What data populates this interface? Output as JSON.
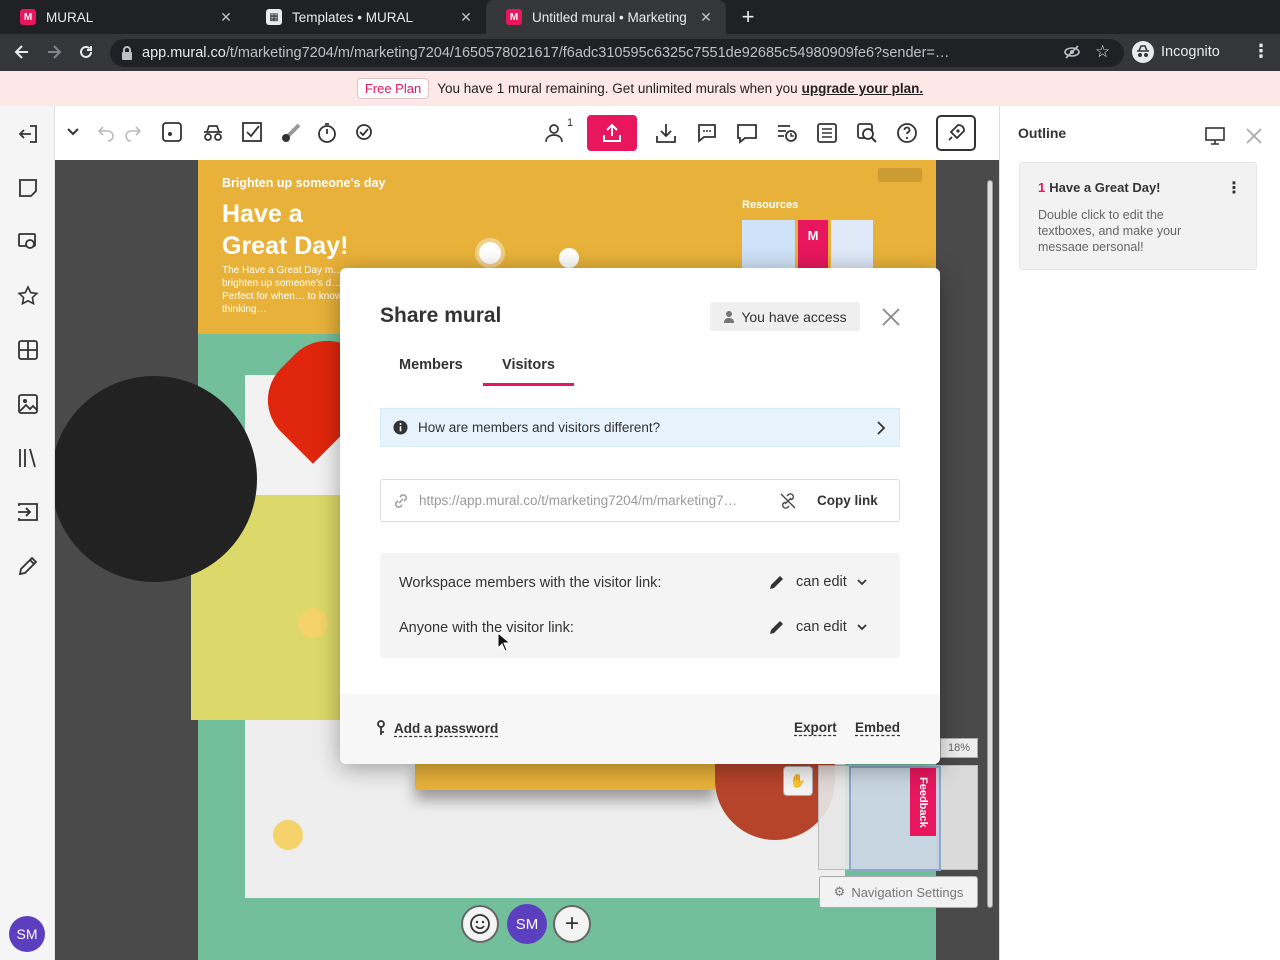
{
  "browser": {
    "tabs": [
      {
        "title": "MURAL",
        "active": false
      },
      {
        "title": "Templates • MURAL",
        "active": false
      },
      {
        "title": "Untitled mural • Marketing",
        "active": true
      }
    ],
    "url_host": "app.mural.co",
    "url_path": "/t/marketing7204/m/marketing7204/1650578021617/f6adc310595c6325c7551de92685c54980909fe6?sender=…",
    "profile_label": "Incognito"
  },
  "banner": {
    "badge": "Free Plan",
    "message": "You have 1 mural remaining. Get unlimited murals when you",
    "link": "upgrade your plan."
  },
  "toolbar": {
    "collaborator_count": "1"
  },
  "canvas": {
    "eyebrow": "Brighten up someone's day",
    "title_line1": "Have a",
    "title_line2": "Great Day!",
    "body": "The Have a Great Day m… brighten up someone's d… group! Perfect for when… to know you are thinking…",
    "resources_label": "Resources",
    "zoom_level": "18%",
    "feedback_label": "Feedback",
    "nav_settings_label": "Navigation Settings",
    "user_initials": "SM"
  },
  "outline": {
    "title": "Outline",
    "item_number": "1",
    "item_title": "Have a Great Day!",
    "item_body": "Double click to edit the textboxes, and make your message personal!"
  },
  "modal": {
    "title": "Share mural",
    "access_badge": "You have access",
    "tabs": [
      {
        "label": "Members",
        "active": false
      },
      {
        "label": "Visitors",
        "active": true
      }
    ],
    "info_text": "How are members and visitors different?",
    "link_value": "https://app.mural.co/t/marketing7204/m/marketing7…",
    "copy_link_label": "Copy link",
    "permissions": [
      {
        "label": "Workspace members with the visitor link:",
        "value": "can edit"
      },
      {
        "label": "Anyone with the visitor link:",
        "value": "can edit"
      }
    ],
    "add_password_label": "Add a password",
    "export_label": "Export",
    "embed_label": "Embed"
  },
  "colors": {
    "brand_accent": "#e8175d",
    "canvas_yellow": "#e8b23a",
    "canvas_green": "#73bf9c",
    "avatar_purple": "#5b3fbf",
    "info_blue": "#e6f3fc"
  }
}
